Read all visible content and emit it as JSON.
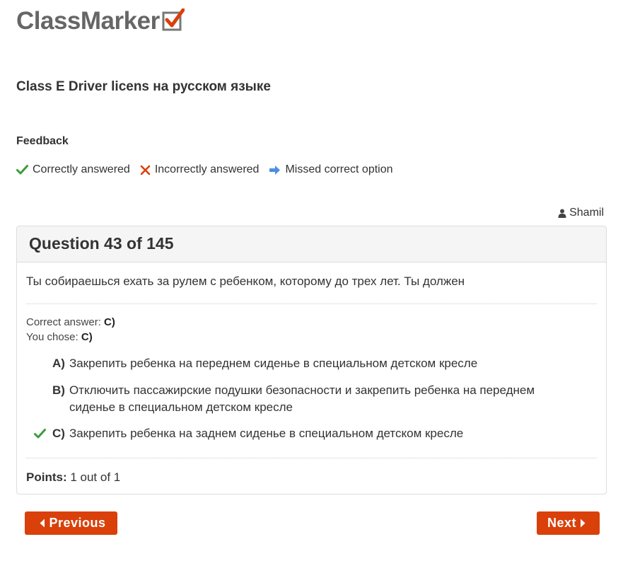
{
  "brand": {
    "logo_text": "ClassMarker",
    "check_color": "#d9400a"
  },
  "quiz": {
    "title": "Class E Driver licens на русском языке"
  },
  "feedback": {
    "heading": "Feedback",
    "legend": [
      {
        "icon": "check-icon",
        "color": "#3c9b3c",
        "label": "Correctly answered"
      },
      {
        "icon": "cross-icon",
        "color": "#d9400a",
        "label": "Incorrectly answered"
      },
      {
        "icon": "arrow-right-icon",
        "color": "#4a90e2",
        "label": "Missed correct option"
      }
    ]
  },
  "user": {
    "icon": "user-icon",
    "name": "Shamil"
  },
  "question": {
    "header": "Question 43 of 145",
    "text": "Ты собираешься ехать за рулем с ребенком, которому до трех лет. Ты должен",
    "correct_answer_label": "Correct answer:",
    "correct_answer_value": "C)",
    "you_chose_label": "You chose:",
    "you_chose_value": "C)",
    "options": [
      {
        "letter": "A)",
        "text": "Закрепить ребенка на переднем сиденье в специальном детском кресле",
        "mark": ""
      },
      {
        "letter": "B)",
        "text": "Отключить пассажирские подушки безопасности и закрепить ребенка на переднем сиденье в специальном детском кресле",
        "mark": ""
      },
      {
        "letter": "C)",
        "text": "Закрепить ребенка на заднем сиденье в специальном детском кресле",
        "mark": "check-icon"
      }
    ],
    "points_label": "Points:",
    "points_value": "1 out of 1"
  },
  "nav": {
    "previous_label": "Previous",
    "next_label": "Next",
    "button_color": "#d9400a"
  }
}
